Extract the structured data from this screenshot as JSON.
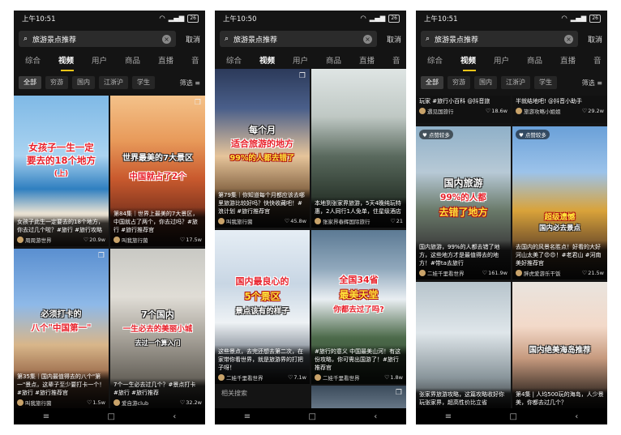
{
  "phone1": {
    "status": {
      "time": "上午10:51",
      "battery": "26"
    },
    "search": {
      "query": "旅游景点推荐",
      "cancel": "取消"
    },
    "tabs": [
      "综合",
      "视频",
      "用户",
      "商品",
      "直播",
      "音"
    ],
    "chips": [
      "全部",
      "穷游",
      "国内",
      "江浙沪",
      "学生"
    ],
    "filter": "筛选",
    "cards": [
      {
        "title_line1": "女孩子一生一定",
        "title_line2": "要去的18个地方",
        "sub": "(上)",
        "caption": "女孩子此生一定要去的18个地方，你去过几个啦？#旅行 #旅行攻略",
        "author": "周周游世界",
        "likes": "20.9w"
      },
      {
        "title_line1": "世界最美的7大景区",
        "title_line2": "中国就占了2个",
        "caption": "第84集｜世界上最美的7大景区，中国就占了两个，你去过吗？#旅行 #旅行推荐官",
        "author": "叫我旅行菌",
        "likes": "17.5w"
      },
      {
        "title_line1": "必须打卡的",
        "title_line2": "八个\"中国第一\"",
        "caption": "第35集｜国内最值得去的八个\"第一\"景点，这辈子至少要打卡一个！#旅行 #旅行推荐官",
        "author": "叫我旅行菌",
        "likes": "1.5w"
      },
      {
        "title_line1": "7个国内",
        "title_line2": "一生必去的美丽小城",
        "sub": "去过一个算入门",
        "caption": "7个一生必去过几个？#景点打卡 #旅行 #旅行推荐",
        "author": "爱自游club",
        "likes": "32.2w"
      }
    ]
  },
  "phone2": {
    "status": {
      "time": "上午10:50",
      "battery": "26"
    },
    "search": {
      "query": "旅游景点推荐",
      "cancel": "取消"
    },
    "tabs": [
      "综合",
      "视频",
      "用户",
      "商品",
      "直播",
      "音"
    ],
    "chips": [
      "全部",
      "穷游",
      "国内",
      "江浙沪",
      "学生"
    ],
    "filter": "筛选",
    "cards": [
      {
        "title_line1": "每个月",
        "title_line2": "适合旅游的地方",
        "sub": "99%的人都去错了",
        "caption": "第79集｜你知道每个月都应该去哪里旅游比较好吗？快快收藏吧！#浪计划 #旅行推荐官",
        "author": "叫我旅行菌",
        "likes": "45.8w"
      },
      {
        "caption": "本地到张家界旅游，5天4晚纯玩特惠，2人同行1人免单，住星级酒店",
        "author": "张家界春辉国际旅行",
        "likes": "21"
      },
      {
        "title_line1": "国内最良心的",
        "title_line2": "5个景区",
        "sub": "景点该有的样子",
        "caption": "这些景点，去完还想去第二次，在家带你看世界，就是旅游界的打把子呀！",
        "author": "二娃千里看世界",
        "likes": "7.1w"
      },
      {
        "title_line1": "全国34省",
        "title_line2": "最美天堂",
        "sub": "你都去过了吗?",
        "caption": "#旅行的意义 中国最美山河！有这份攻略，你可需出国游了！#旅行推荐官",
        "author": "二娃千里看世界",
        "likes": "1.8w"
      }
    ],
    "related": "相关搜索"
  },
  "phone3": {
    "status": {
      "time": "上午10:51",
      "battery": "26"
    },
    "search": {
      "query": "旅游景点推荐",
      "cancel": "取消"
    },
    "tabs": [
      "综合",
      "视频",
      "用户",
      "商品",
      "直播",
      "音"
    ],
    "chips": [
      "全部",
      "穷游",
      "国内",
      "江浙沪",
      "学生"
    ],
    "filter": "筛选",
    "top_left": {
      "caption": "玩家 #旅行小百科 @抖音旅",
      "author": "遇见国旅行",
      "likes": "18.6w"
    },
    "top_right": {
      "caption": "半就结地吧! @抖音小助手",
      "author": "旅游攻略小姐姐",
      "likes": "29.2w"
    },
    "cards": [
      {
        "badge": "点赞较多",
        "title_line1": "国内旅游",
        "title_line2": "99%的人都",
        "sub": "去错了地方",
        "caption": "国内旅游，99%的人都去错了地方，这些地方才是最值得去的地方！#带ta去旅行",
        "author": "二娃千里看世界",
        "likes": "161.9w"
      },
      {
        "badge": "点赞较多",
        "title_line1": "超级遗憾",
        "title_line2": "国内必去景点",
        "caption": "去国内的风景名胜点！好看的大好河山太美了😍😍！#老君山 #河南美好推荐官",
        "author": "胖虎爱游乐干饭",
        "likes": "21.5w"
      },
      {
        "caption": "张家界旅游攻略，这篇攻略收好你玩张家界，超高性价比立省",
        "author": "",
        "likes": ""
      },
      {
        "title_line1": "国内绝美海岛推荐",
        "caption": "第4集 | 人均500玩的海岛，人少景美，你都去过几个？",
        "author": "",
        "likes": ""
      }
    ]
  },
  "navbar": [
    "≡",
    "□",
    "‹"
  ]
}
